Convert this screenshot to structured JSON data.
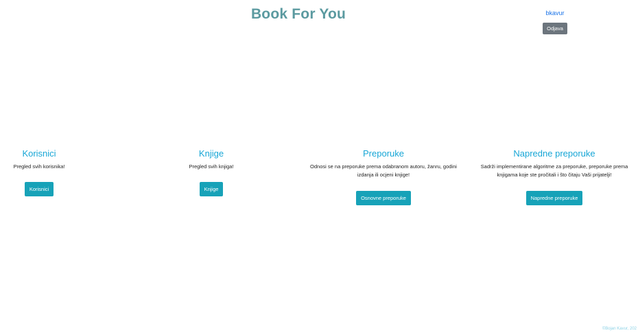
{
  "header": {
    "title": "Book For You",
    "username": "bkavur",
    "logout_label": "Odjava"
  },
  "cards": [
    {
      "title": "Korisnici",
      "description": "Pregled svih korisnika!",
      "button_label": "Korisnici"
    },
    {
      "title": "Knjige",
      "description": "Pregled svih knjiga!",
      "button_label": "Knjige"
    },
    {
      "title": "Preporuke",
      "description": "Odnosi se na preporuke prema odabranom autoru, žanru, godini izdanja ili ocjeni knjige!",
      "button_label": "Osnovne preporuke"
    },
    {
      "title": "Napredne preporuke",
      "description": "Sadrži implementirane algoritme za preporuke, preporuke prema knjigama koje ste pročitali i što čitaju Vaši prijatelji!",
      "button_label": "Napredne preporuke"
    }
  ],
  "footer": {
    "text": "©Bojan Kavur, 202"
  },
  "colors": {
    "title": "#5b9aa0",
    "card_title": "#17a6d6",
    "primary_button": "#17a2b8",
    "secondary_button": "#6c757d",
    "link": "#1a73e8"
  }
}
